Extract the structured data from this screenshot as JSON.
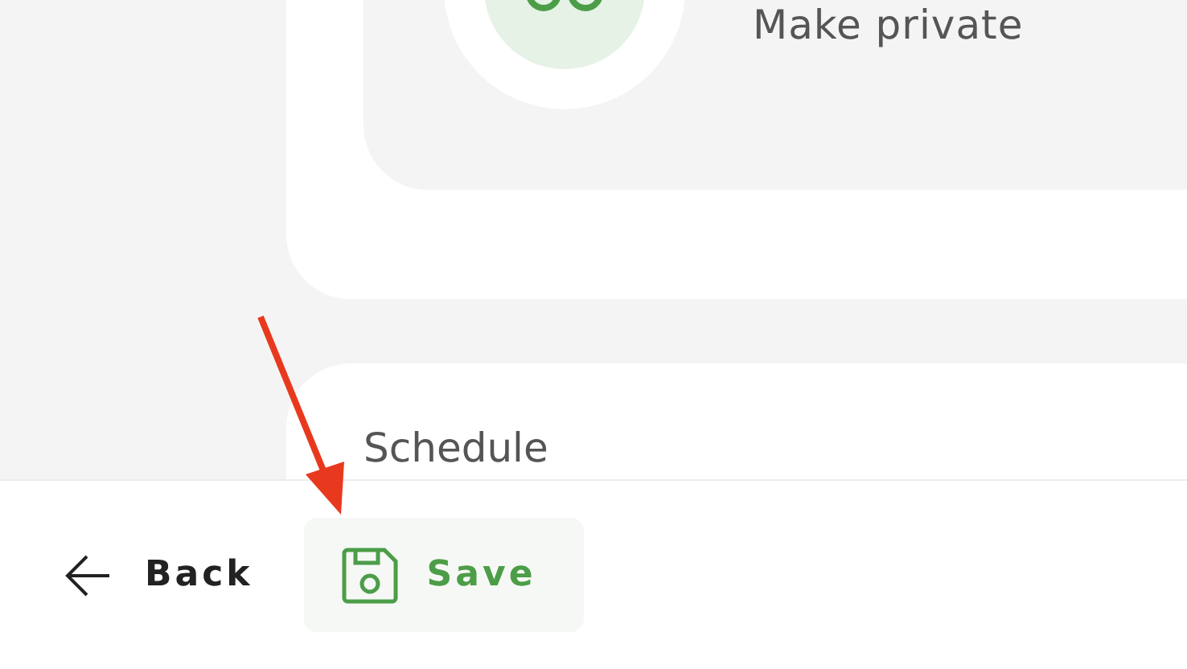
{
  "privacy_card": {
    "option_label": "Make private"
  },
  "schedule_card": {
    "title": "Schedule"
  },
  "footer": {
    "buttons": [
      {
        "kind": "back",
        "label": "Back"
      },
      {
        "kind": "save",
        "label": "Save"
      }
    ]
  }
}
